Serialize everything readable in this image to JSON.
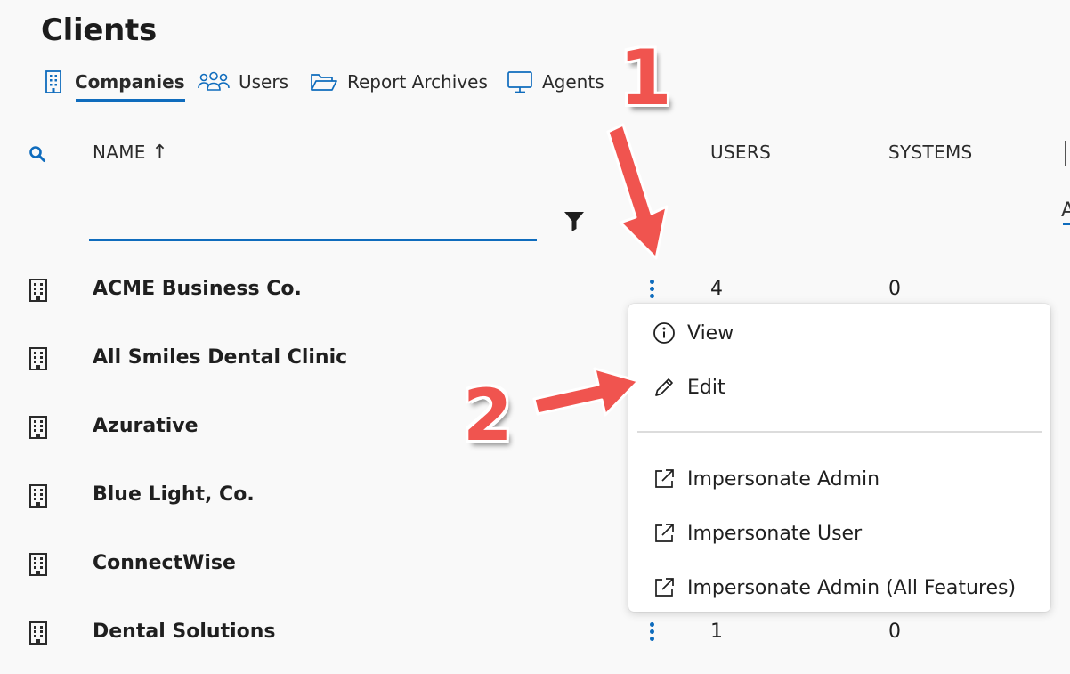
{
  "page": {
    "title": "Clients"
  },
  "tabs": [
    {
      "label": "Companies",
      "icon": "building-icon",
      "active": true
    },
    {
      "label": "Users",
      "icon": "people-icon",
      "active": false
    },
    {
      "label": "Report Archives",
      "icon": "folder-open-icon",
      "active": false
    },
    {
      "label": "Agents",
      "icon": "monitor-icon",
      "active": false
    }
  ],
  "table": {
    "columns": {
      "name": "NAME",
      "sort_indicator": "↑",
      "users": "USERS",
      "systems": "SYSTEMS"
    },
    "cut_off_filter_value": "A",
    "name_filter_value": "",
    "rows": [
      {
        "name": "ACME Business Co.",
        "users": "4",
        "systems": "0"
      },
      {
        "name": "All Smiles Dental Clinic",
        "users": "",
        "systems": ""
      },
      {
        "name": "Azurative",
        "users": "",
        "systems": ""
      },
      {
        "name": "Blue Light, Co.",
        "users": "",
        "systems": ""
      },
      {
        "name": "ConnectWise",
        "users": "",
        "systems": ""
      },
      {
        "name": "Dental Solutions",
        "users": "1",
        "systems": "0"
      }
    ]
  },
  "context_menu": {
    "items": [
      {
        "label": "View",
        "icon": "info-circle-icon"
      },
      {
        "label": "Edit",
        "icon": "pencil-icon"
      },
      {
        "label": "Impersonate Admin",
        "icon": "open-external-icon"
      },
      {
        "label": "Impersonate User",
        "icon": "open-external-icon"
      },
      {
        "label": "Impersonate Admin (All Features)",
        "icon": "open-external-icon"
      }
    ]
  },
  "annotations": {
    "step1": "1",
    "step2": "2"
  },
  "colors": {
    "accent": "#0f6cbd",
    "annotation": "#f0544f",
    "background": "#f9f9f9",
    "menu_background": "#ffffff"
  }
}
